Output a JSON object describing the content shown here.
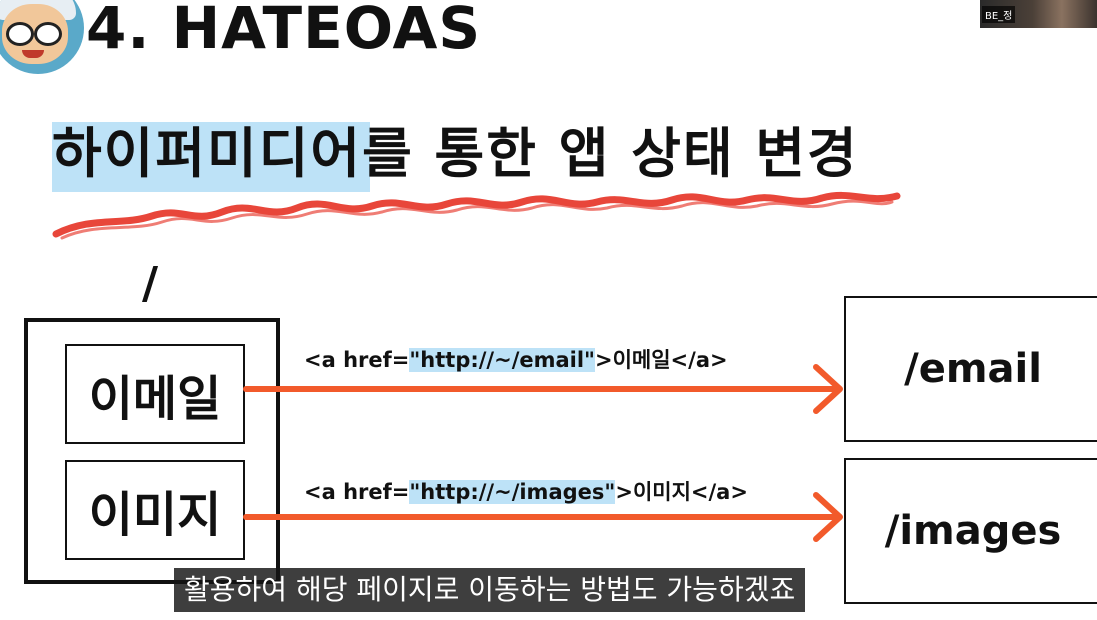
{
  "slide": {
    "title": "4. HATEOAS",
    "subtitle": "하이퍼미디어를 통한 앱 상태 변경",
    "root_path": "/"
  },
  "webcam": {
    "label": "BE_정"
  },
  "links": [
    {
      "label": "이메일",
      "code_prefix": "<a href=",
      "code_href": "\"http://~/email\"",
      "code_suffix": ">이메일</a>",
      "target": "/email"
    },
    {
      "label": "이미지",
      "code_prefix": "<a href=",
      "code_href": "\"http://~/images\"",
      "code_suffix": ">이미지</a>",
      "target": "/images"
    }
  ],
  "caption": "활용하여 해당 페이지로 이동하는 방법도 가능하겠죠",
  "colors": {
    "accent_arrow": "#f25a2b",
    "highlight": "#bde2f7",
    "squiggle": "#e8463a"
  },
  "icons": {
    "avatar": "cartoon-avatar-icon"
  }
}
